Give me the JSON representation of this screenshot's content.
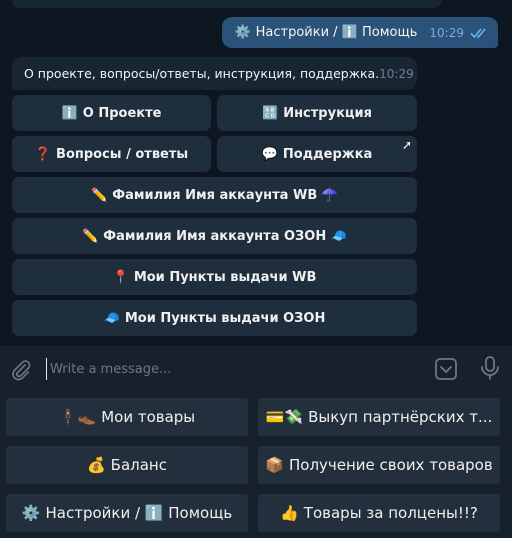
{
  "messages": {
    "outgoing": {
      "emoji": "⚙️",
      "text": "Настройки / ℹ️ Помощь",
      "time": "10:29"
    },
    "incoming": {
      "text": "О проекте, вопросы/ответы, инструкция, поддержка.",
      "time": "10:29"
    }
  },
  "inline_keyboard": [
    {
      "emoji": "ℹ️",
      "label": "О Проекте"
    },
    {
      "emoji": "🔠",
      "label": "Инструкция"
    },
    {
      "emoji": "❓",
      "label": "Вопросы / ответы"
    },
    {
      "emoji": "💬",
      "label": "Поддержка",
      "arrow": "➚"
    },
    {
      "emoji": "✏️",
      "label": "Фамилия Имя аккаунта WB ☂️"
    },
    {
      "emoji": "✏️",
      "label": "Фамилия Имя аккаунта ОЗОН 🧢"
    },
    {
      "emoji": "📍",
      "label": "Мои Пункты выдачи WB"
    },
    {
      "emoji": "🧢",
      "label": "Мои Пункты выдачи ОЗОН"
    }
  ],
  "composer": {
    "placeholder": "Write a message..."
  },
  "reply_keyboard": [
    {
      "emoji": "🕴👞",
      "label": "Мои товары"
    },
    {
      "emoji": "💳💸",
      "label": "Выкуп партнёрских т..."
    },
    {
      "emoji": "💰",
      "label": "Баланс"
    },
    {
      "emoji": "📦",
      "label": "Получение своих товаров"
    },
    {
      "emoji": "⚙️",
      "label": "Настройки / ℹ️ Помощь"
    },
    {
      "emoji": "👍",
      "label": "Товары за полцены!!?"
    }
  ],
  "colors": {
    "chat_bg": "#0e1621",
    "outgoing_bubble": "#2b5278",
    "incoming_bubble": "#182533",
    "button_bg": "#1f2e3d",
    "panel_bg": "#17212b",
    "tick_blue": "#64b3f0"
  },
  "icons": {
    "attach": "paperclip-icon",
    "keyboard": "keyboard-toggle-icon",
    "mic": "microphone-icon",
    "read": "double-check-icon"
  }
}
